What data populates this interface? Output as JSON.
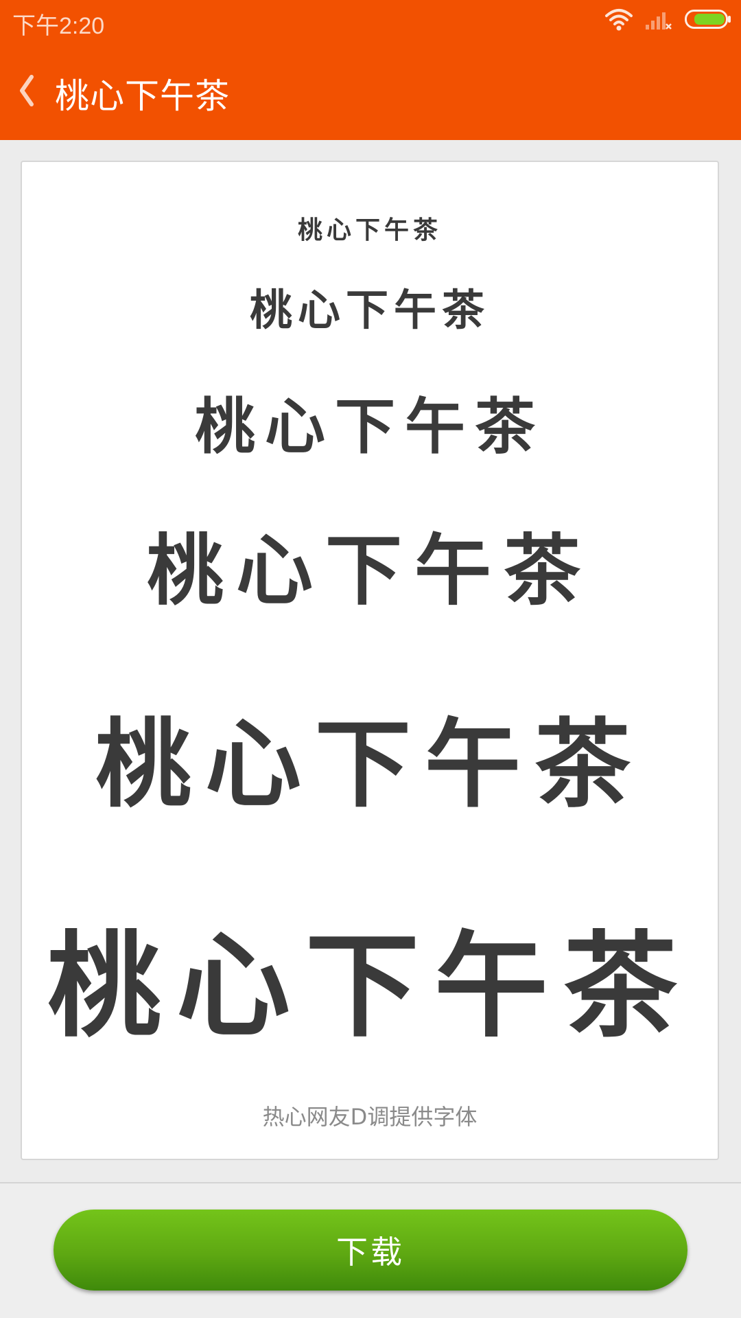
{
  "status_bar": {
    "time": "下午2:20"
  },
  "header": {
    "title": "桃心下午茶"
  },
  "preview": {
    "samples": [
      "桃心下午茶",
      "桃心下午茶",
      "桃心下午茶",
      "桃心下午茶",
      "桃心下午茶",
      "桃心下午茶"
    ],
    "credit": "热心网友D调提供字体"
  },
  "footer": {
    "download_label": "下载"
  },
  "colors": {
    "accent": "#f25101",
    "button": "#5ea812",
    "battery": "#7ed321"
  },
  "icons": {
    "back": "chevron-left-icon",
    "wifi": "wifi-icon",
    "signal": "signal-icon",
    "battery": "battery-icon"
  }
}
